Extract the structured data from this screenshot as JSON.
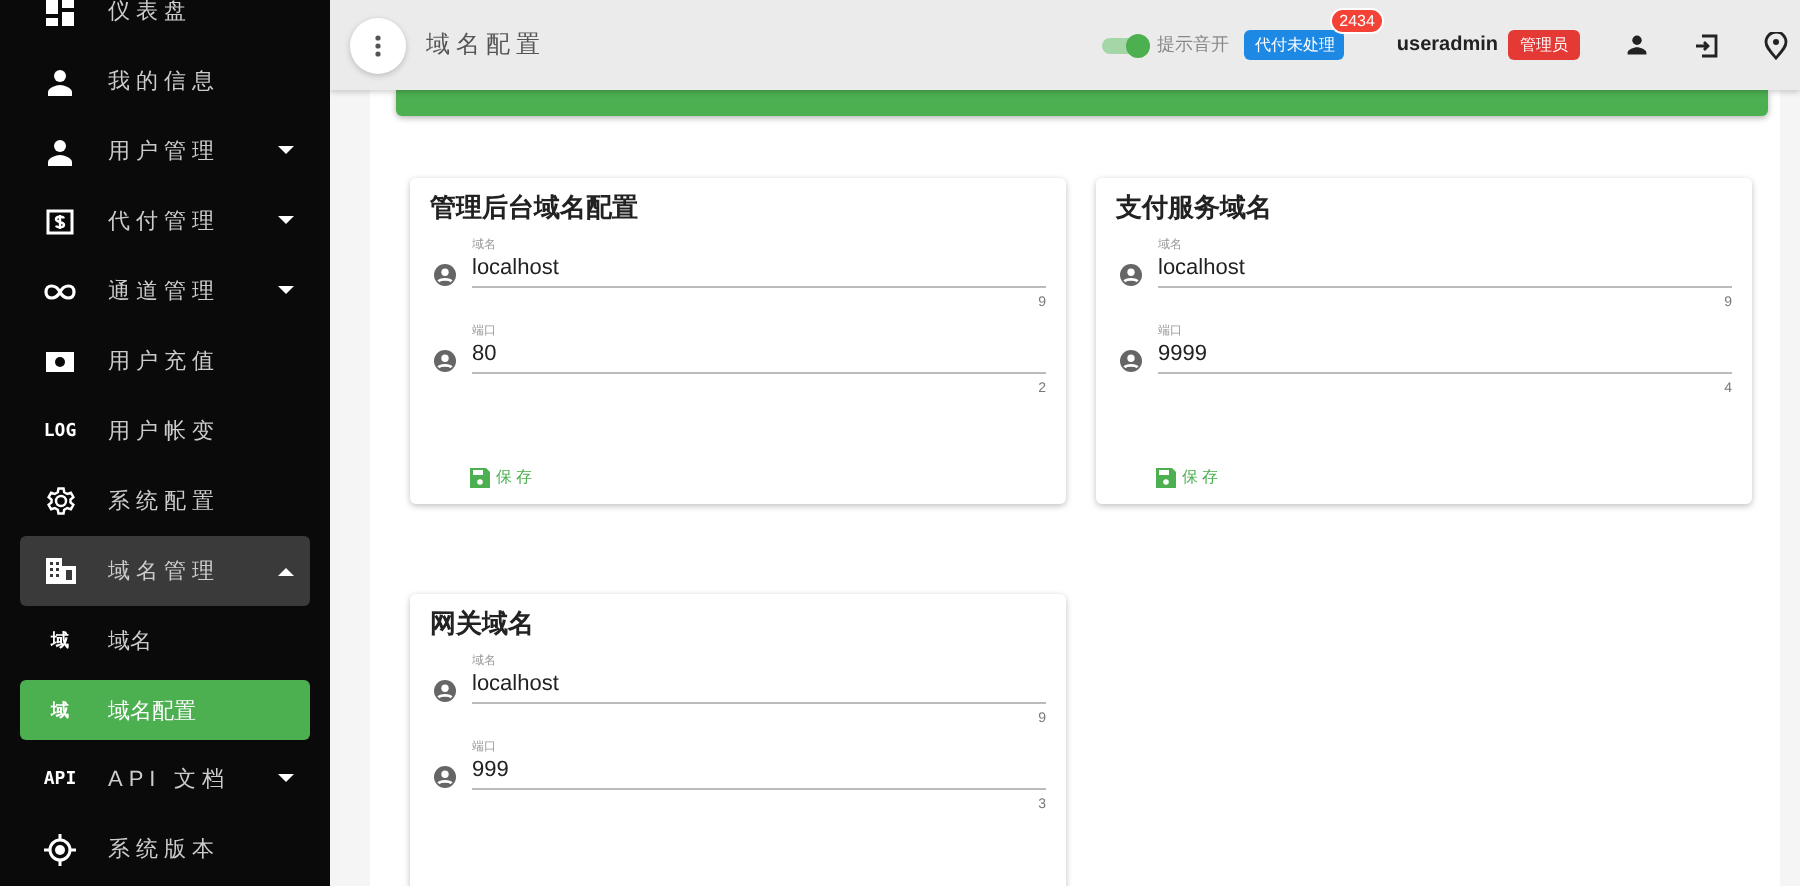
{
  "sidebar": {
    "items": [
      {
        "label": "仪表盘",
        "selected": false
      },
      {
        "label": "我的信息",
        "selected": false
      },
      {
        "label": "用户管理",
        "selected": false,
        "expanded": false
      },
      {
        "label": "代付管理",
        "selected": false,
        "expanded": false
      },
      {
        "label": "通道管理",
        "selected": false,
        "expanded": false
      },
      {
        "label": "用户充值",
        "selected": false
      },
      {
        "label": "用户帐变",
        "icon_text": "LOG",
        "selected": false
      },
      {
        "label": "系统配置",
        "selected": false
      },
      {
        "label": "域名管理",
        "selected": false,
        "expanded": true,
        "children": [
          {
            "label": "域名",
            "icon_text": "域",
            "selected": false
          },
          {
            "label": "域名配置",
            "icon_text": "域",
            "selected": true
          }
        ]
      },
      {
        "label": "API 文档",
        "icon_text": "API",
        "selected": false,
        "expanded": false
      },
      {
        "label": "系统版本",
        "selected": false
      }
    ]
  },
  "header": {
    "title": "域名配置",
    "sound": {
      "label": "提示音开",
      "on": true
    },
    "pending": {
      "label": "代付未处理",
      "count": "2434"
    },
    "user": "useradmin",
    "role": "管理员"
  },
  "cards": [
    {
      "title": "管理后台域名配置",
      "fields": [
        {
          "label": "域名",
          "value": "localhost",
          "counter": "9"
        },
        {
          "label": "端口",
          "value": "80",
          "counter": "2"
        }
      ],
      "save": "保存"
    },
    {
      "title": "支付服务域名",
      "fields": [
        {
          "label": "域名",
          "value": "localhost",
          "counter": "9"
        },
        {
          "label": "端口",
          "value": "9999",
          "counter": "4"
        }
      ],
      "save": "保存"
    },
    {
      "title": "网关域名",
      "fields": [
        {
          "label": "域名",
          "value": "localhost",
          "counter": "9"
        },
        {
          "label": "端口",
          "value": "999",
          "counter": "3"
        }
      ]
    }
  ]
}
